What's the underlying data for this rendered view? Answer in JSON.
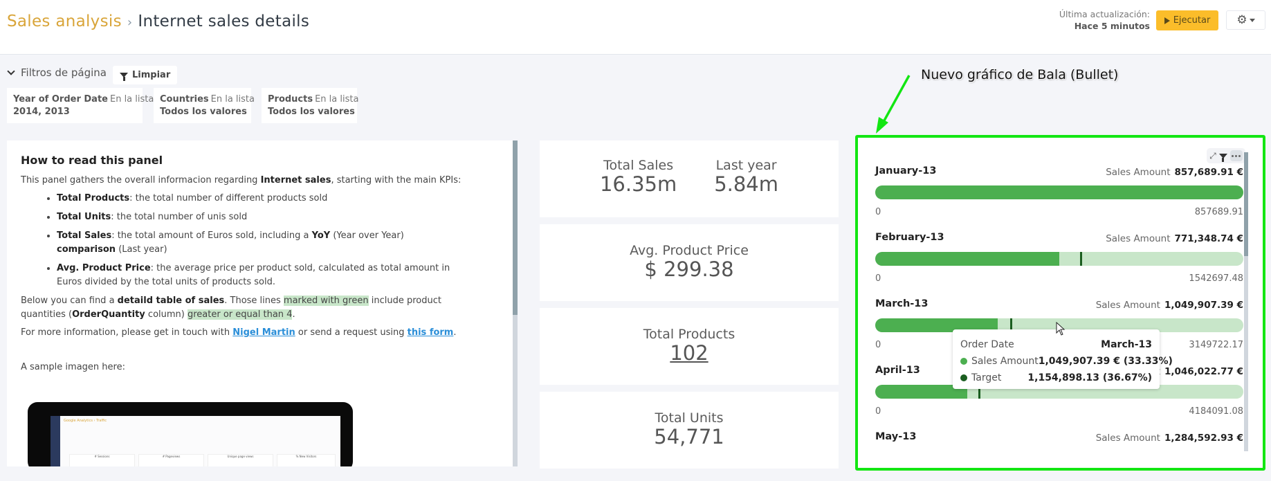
{
  "header": {
    "breadcrumb_parent": "Sales analysis",
    "breadcrumb_separator": "›",
    "title": "Internet sales details",
    "last_update_label": "Última actualización:",
    "last_update_value": "Hace 5 minutos",
    "run_label": "Ejecutar",
    "settings_icon": "gear-icon"
  },
  "filters": {
    "heading": "Filtros de página",
    "clear_label": "Limpiar",
    "items": [
      {
        "name": "Year of Order Date",
        "operator": "En la lista",
        "values": "2014, 2013"
      },
      {
        "name": "Countries",
        "operator": "En la lista",
        "values": "Todos los valores"
      },
      {
        "name": "Products",
        "operator": "En la lista",
        "values": "Todos los valores"
      }
    ]
  },
  "info_panel": {
    "title": "How to read this panel",
    "intro_pre": "This panel gathers the overall informacion regarding ",
    "intro_bold": "Internet sales",
    "intro_post": ", starting with the main KPIs:",
    "bullets": [
      {
        "bold": "Total Products",
        "text": ": the total number of different products sold"
      },
      {
        "bold": "Total Units",
        "text": ": the total number of unis sold"
      },
      {
        "bold": "Total Sales",
        "text": ": the total amount of Euros sold, including a ",
        "bold2": "YoY",
        "text2": " (Year over Year) ",
        "bold3": "comparison",
        "text3": " (Last year)"
      },
      {
        "bold": "Avg. Product Price",
        "text": ": the average price per product sold, calculated as total amount in Euros divided by the total units of products sold."
      }
    ],
    "table_p": {
      "t1": "Below you can find a ",
      "b1": "detaild table of sales",
      "t2": ". Those lines ",
      "h1": "marked with green",
      "t3": " include product quantities (",
      "b2": "OrderQuantity",
      "t4": " column) ",
      "h2": "greater or equal than 4",
      "t5": "."
    },
    "contact_p": {
      "t1": "For more information, please get in touch with ",
      "link1": "Nigel Martin",
      "t2": " or send a request using ",
      "link2": "this form",
      "t3": "."
    },
    "sample_label": "A sample imagen here:",
    "sample_image": {
      "title": "Google Analytics › Traffic",
      "cards": [
        "# Sessions",
        "# Pageviews",
        "Unique page views",
        "% New Visitors"
      ]
    }
  },
  "kpis": {
    "total_sales": {
      "label": "Total Sales",
      "value": "16.35m"
    },
    "last_year": {
      "label": "Last year",
      "value": "5.84m"
    },
    "avg_price": {
      "label": "Avg. Product Price",
      "value": "$ 299.38"
    },
    "total_products": {
      "label": "Total Products",
      "value": "102"
    },
    "total_units": {
      "label": "Total Units",
      "value": "54,771"
    }
  },
  "annotation": {
    "text": "Nuevo gráfico de Bala (Bullet)",
    "color": "#13e613"
  },
  "bullet_widget": {
    "measure_label": "Sales Amount",
    "tools": [
      "expand-icon",
      "filter-icon",
      "more-icon"
    ]
  },
  "chart_data": {
    "type": "bar",
    "subtype": "bullet",
    "title": "",
    "measure": "Sales Amount",
    "categories": [
      "January-13",
      "February-13",
      "March-13",
      "April-13",
      "May-13"
    ],
    "series": [
      {
        "name": "Sales Amount",
        "values": [
          857689.91,
          771348.74,
          1049907.39,
          1046022.77,
          1284592.93
        ],
        "display": [
          "857,689.91 €",
          "771,348.74 €",
          "1,049,907.39 €",
          "1,046,022.77 €",
          "1,284,592.93 €"
        ],
        "color": "#4caf50"
      },
      {
        "name": "Target",
        "values": [
          null,
          859500,
          1154898.13,
          1171545.5,
          null
        ],
        "color": "#1b5e20"
      }
    ],
    "ranges": [
      {
        "min": 0,
        "max": 857689.91,
        "max_label": "857689.91"
      },
      {
        "min": 0,
        "max": 1542697.48,
        "max_label": "1542697.48"
      },
      {
        "min": 0,
        "max": 3149722.17,
        "max_label": "3149722.17"
      },
      {
        "min": 0,
        "max": 4184091.08,
        "max_label": "4184091.08"
      },
      {
        "min": 0,
        "max": 6422964.65,
        "max_label": ""
      }
    ],
    "min_label": "0",
    "track_color": "#c8e6c9",
    "tooltip": {
      "header_label": "Order Date",
      "header_value": "March-13",
      "rows": [
        {
          "label": "Sales Amount",
          "value": "1,049,907.39 € (33.33%)",
          "color": "#4caf50"
        },
        {
          "label": "Target",
          "value": "1,154,898.13 (36.67%)",
          "color": "#1b5e20"
        }
      ]
    }
  }
}
